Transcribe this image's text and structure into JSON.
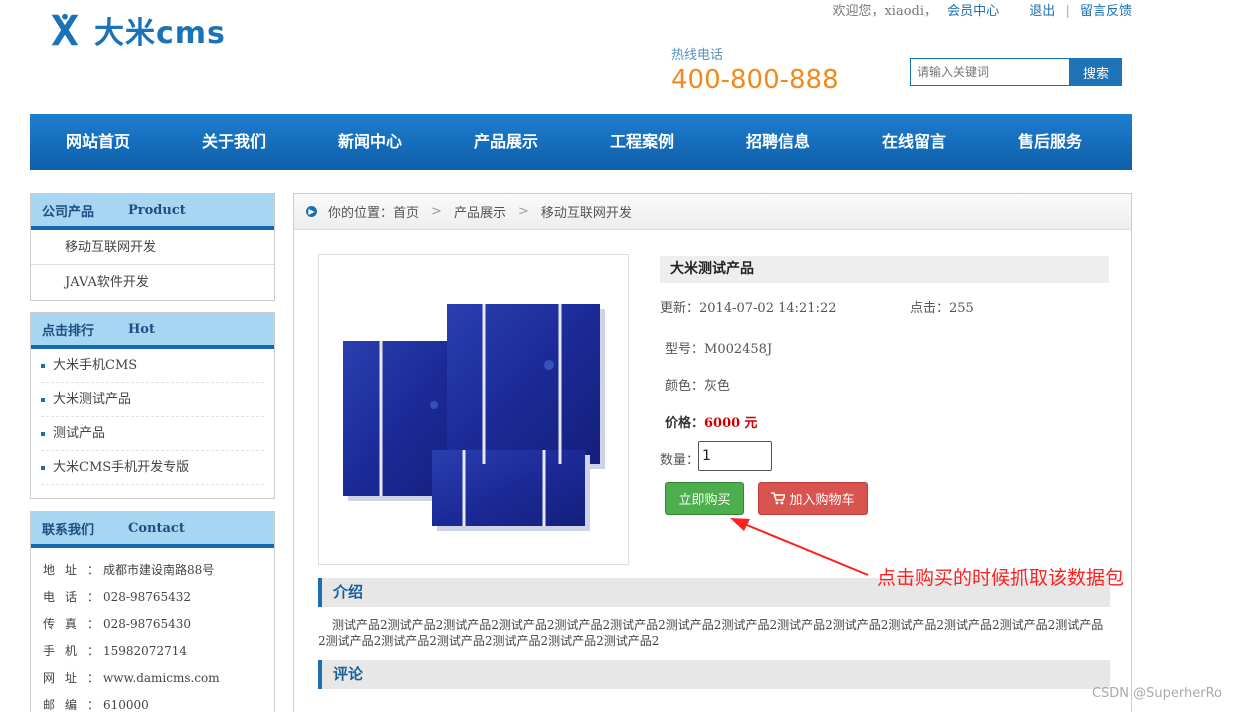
{
  "header": {
    "logo_text": "大米cms",
    "welcome": "欢迎您，xiaodi，",
    "member_center": "会员中心",
    "logout": "退出",
    "sep": "|",
    "feedback": "留言反馈",
    "hotline_label": "热线电话",
    "hotline_number": "400-800-888",
    "search_placeholder": "请输入关键词",
    "search_button": "搜索"
  },
  "nav": [
    "网站首页",
    "关于我们",
    "新闻中心",
    "产品展示",
    "工程案例",
    "招聘信息",
    "在线留言",
    "售后服务"
  ],
  "sidebar": {
    "products": {
      "title": "公司产品",
      "title_en": "Product",
      "items": [
        "移动互联网开发",
        "JAVA软件开发"
      ]
    },
    "hot": {
      "title": "点击排行",
      "title_en": "Hot",
      "items": [
        "大米手机CMS",
        "大米测试产品",
        "测试产品",
        "大米CMS手机开发专版"
      ]
    },
    "contact": {
      "title": "联系我们",
      "title_en": "Contact",
      "lines": [
        {
          "label": "地址：",
          "value": "成都市建设南路88号"
        },
        {
          "label": "电话：",
          "value": "028-98765432"
        },
        {
          "label": "传真：",
          "value": "028-98765430"
        },
        {
          "label": "手机：",
          "value": "15982072714"
        },
        {
          "label": "网址：",
          "value": "www.damicms.com"
        },
        {
          "label": "邮编：",
          "value": "610000"
        }
      ]
    }
  },
  "breadcrumb": {
    "label": "你的位置：",
    "items": [
      "首页",
      "产品展示",
      "移动互联网开发"
    ],
    "separator": ">"
  },
  "product": {
    "title": "大米测试产品",
    "updated_label": "更新：",
    "updated": "2014-07-02 14:21:22",
    "clicks_label": "点击：",
    "clicks": "255",
    "model_label": "型号：",
    "model": "M002458J",
    "color_label": "颜色：",
    "color": "灰色",
    "price_label": "价格：",
    "price": "6000",
    "price_unit": "元",
    "qty_label": "数量：",
    "qty_value": "1",
    "buy_button": "立即购买",
    "cart_button": "加入购物车"
  },
  "sections": {
    "intro_title": "介绍",
    "intro_text": "测试产品2测试产品2测试产品2测试产品2测试产品2测试产品2测试产品2测试产品2测试产品2测试产品2测试产品2测试产品2测试产品2测试产品2测试产品2测试产品2测试产品2测试产品2测试产品2测试产品2",
    "review_title": "评论"
  },
  "annotation": "点击购买的时候抓取该数据包",
  "watermark": "CSDN @SuperherRo",
  "colors": {
    "brand_blue": "#1a73b8",
    "hotline_orange": "#f08a1c",
    "buy_green": "#4cae4c",
    "cart_red": "#d9534f",
    "annotation_red": "#ff2020"
  }
}
